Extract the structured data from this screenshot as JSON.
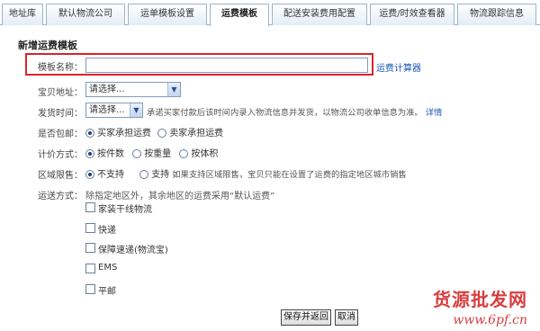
{
  "tabs": [
    {
      "label": "地址库",
      "active": false
    },
    {
      "label": "默认物流公司",
      "active": false
    },
    {
      "label": "运单模板设置",
      "active": false
    },
    {
      "label": "运费模板",
      "active": true
    },
    {
      "label": "配送安装费用配置",
      "active": false
    },
    {
      "label": "运费/时效查看器",
      "active": false
    },
    {
      "label": "物流跟踪信息",
      "active": false
    }
  ],
  "form": {
    "heading": "新增运费模板",
    "template_name": {
      "label": "模板名称：",
      "value": "",
      "link": "运费计算器"
    },
    "location": {
      "label": "宝贝地址：",
      "selected": "请选择..."
    },
    "ship_time": {
      "label": "发货时间：",
      "selected": "请选择...",
      "hint": "承诺买家付款后该时间内录入物流信息并发货，以物流公司收单信息为准。",
      "detail_link": "详情"
    },
    "free_shipping": {
      "label": "是否包邮：",
      "options": [
        {
          "label": "买家承担运费",
          "checked": true
        },
        {
          "label": "卖家承担运费",
          "checked": false
        }
      ]
    },
    "pricing": {
      "label": "计价方式：",
      "options": [
        {
          "label": "按件数",
          "checked": true
        },
        {
          "label": "按重量",
          "checked": false
        },
        {
          "label": "按体积",
          "checked": false
        }
      ]
    },
    "region_limit": {
      "label": "区域限售：",
      "options": [
        {
          "label": "不支持",
          "checked": true
        },
        {
          "label": "支持",
          "checked": false
        }
      ],
      "hint": "如果支持区域限售，宝贝只能在设置了运费的指定地区城市销售"
    },
    "delivery": {
      "label": "运送方式：",
      "hint": "除指定地区外，其余地区的运费采用“默认运费”",
      "methods": [
        {
          "label": "家装干线物流",
          "checked": false
        },
        {
          "label": "快递",
          "checked": false
        },
        {
          "label": "保障速递(物流宝)",
          "checked": false
        },
        {
          "label": "EMS",
          "checked": false
        },
        {
          "label": "平邮",
          "checked": false
        }
      ]
    }
  },
  "buttons": {
    "save": "保存并返回",
    "cancel": "取消"
  },
  "watermark": {
    "text": "货源批发网",
    "url": "www.6pf.cn"
  },
  "colors": {
    "highlight": "#d9232a",
    "link": "#1a56b8",
    "tab_border": "#9cb3c9"
  }
}
